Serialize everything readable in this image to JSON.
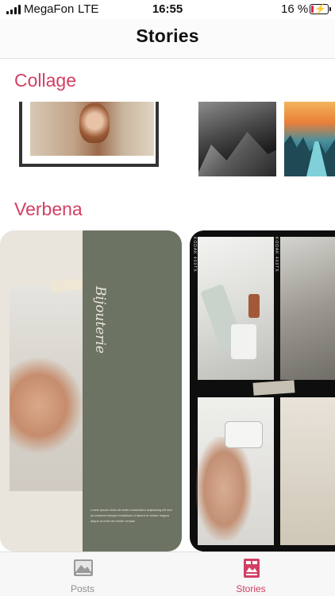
{
  "status_bar": {
    "carrier": "MegaFon",
    "network": "LTE",
    "time": "16:55",
    "battery_percent": "16 %",
    "battery_level": 0.16,
    "battery_color": "#e8204a"
  },
  "nav": {
    "title": "Stories"
  },
  "sections": {
    "collage": {
      "title": "Collage"
    },
    "verbena": {
      "title": "Verbena",
      "card_script_text": "Bijouterie",
      "card_body_text": "Lorem ipsum dolor sit amet consectetur adipiscing elit sed do eiusmod tempor incididunt ut labore et dolore magna aliqua ut enim ad minim veniam"
    }
  },
  "kodak_strip_text": "KODAK 400TX",
  "tab_bar": {
    "posts_label": "Posts",
    "stories_label": "Stories",
    "active_tab": "Stories",
    "accent_color": "#d23f62",
    "inactive_color": "#8e8e8e"
  },
  "icons": {
    "posts": "image-icon",
    "stories": "story-icon"
  }
}
